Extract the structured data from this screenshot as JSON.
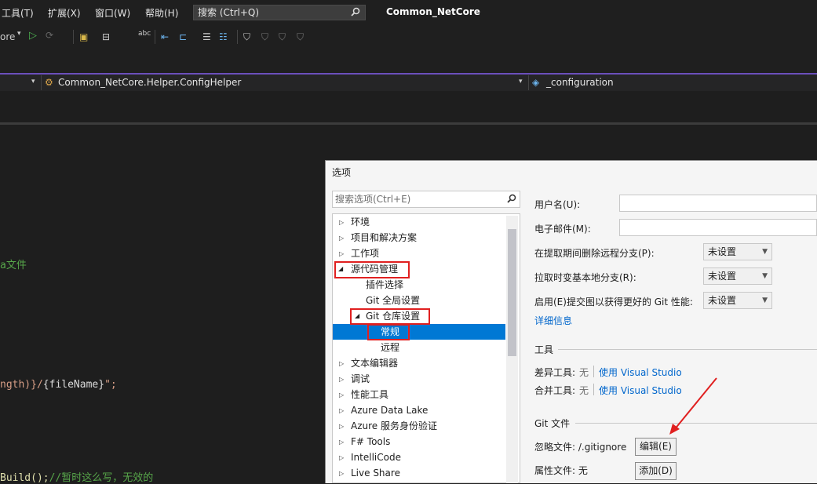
{
  "menu": {
    "items": [
      "工具(T)",
      "扩展(X)",
      "窗口(W)",
      "帮助(H)"
    ],
    "search_placeholder": "搜索 (Ctrl+Q)",
    "app_title": "Common_NetCore"
  },
  "toolbar": {
    "config_fragment": "ore"
  },
  "navbar": {
    "class_path": "Common_NetCore.Helper.ConfigHelper",
    "member": "_configuration"
  },
  "editor": {
    "line1": "a文件",
    "line2_a": "ngth)}/",
    "line2_b": "{fileName}",
    "line2_c": "\";",
    "line3_a": "Build();",
    "line3_b": "//暂时这么写，无效的"
  },
  "dialog": {
    "title": "选项",
    "search_placeholder": "搜索选项(Ctrl+E)",
    "tree": [
      {
        "label": "环境",
        "level": 0,
        "expanded": false
      },
      {
        "label": "项目和解决方案",
        "level": 0,
        "expanded": false
      },
      {
        "label": "工作项",
        "level": 0,
        "expanded": false
      },
      {
        "label": "源代码管理",
        "level": 0,
        "expanded": true,
        "highlighted": true
      },
      {
        "label": "插件选择",
        "level": 1
      },
      {
        "label": "Git 全局设置",
        "level": 1
      },
      {
        "label": "Git 仓库设置",
        "level": 1,
        "expanded": true,
        "highlighted": true
      },
      {
        "label": "常规",
        "level": 2,
        "selected": true,
        "highlighted": true
      },
      {
        "label": "远程",
        "level": 2
      },
      {
        "label": "文本编辑器",
        "level": 0,
        "expanded": false
      },
      {
        "label": "调试",
        "level": 0,
        "expanded": false
      },
      {
        "label": "性能工具",
        "level": 0,
        "expanded": false
      },
      {
        "label": "Azure Data Lake",
        "level": 0,
        "expanded": false
      },
      {
        "label": "Azure 服务身份验证",
        "level": 0,
        "expanded": false
      },
      {
        "label": "F# Tools",
        "level": 0,
        "expanded": false
      },
      {
        "label": "IntelliCode",
        "level": 0,
        "expanded": false
      },
      {
        "label": "Live Share",
        "level": 0,
        "expanded": false
      }
    ],
    "settings": {
      "username_label": "用户名(U):",
      "email_label": "电子邮件(M):",
      "prune_label": "在提取期间删除远程分支(P):",
      "prune_value": "未设置",
      "rebase_label": "拉取时变基本地分支(R):",
      "rebase_value": "未设置",
      "commitgraph_label": "启用(E)提交图以获得更好的 Git 性能:",
      "commitgraph_value": "未设置",
      "details_link": "详细信息",
      "tools_header": "工具",
      "diff_label": "差异工具:",
      "diff_value": "无",
      "diff_link": "使用 Visual Studio",
      "merge_label": "合并工具:",
      "merge_value": "无",
      "merge_link": "使用 Visual Studio",
      "gitfiles_header": "Git 文件",
      "ignore_label": "忽略文件: /.gitignore",
      "ignore_button": "编辑(E)",
      "attr_label": "属性文件: 无",
      "attr_button": "添加(D)"
    }
  },
  "colors": {
    "selection": "#0078d4",
    "annotation_red": "#e02020",
    "link": "#0066cc",
    "accent_purple": "#6b4fbb"
  }
}
